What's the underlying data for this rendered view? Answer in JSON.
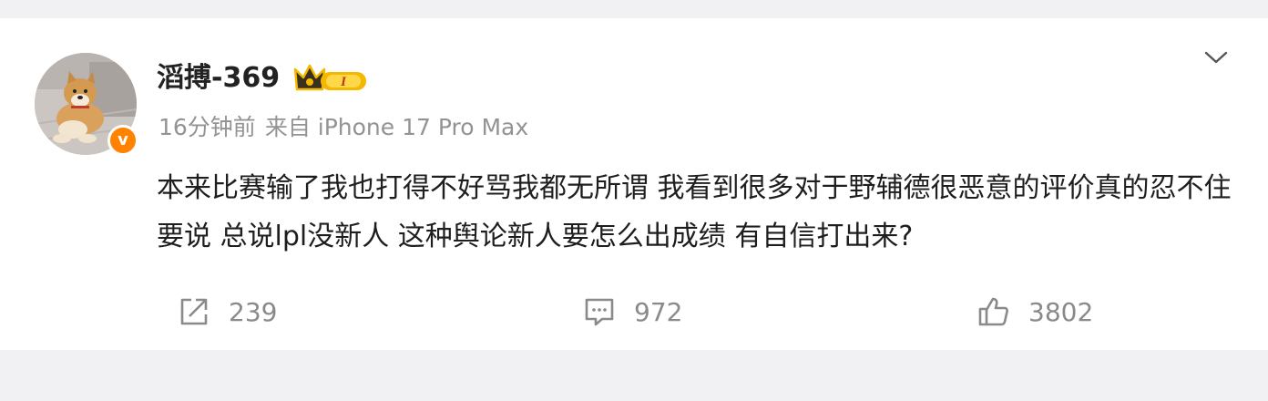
{
  "post": {
    "username": "滔搏-369",
    "level_badge": "I",
    "time": "16分钟前",
    "source": "来自 iPhone 17 Pro Max",
    "verified_mark": "v",
    "text": "本来比赛输了我也打得不好骂我都无所谓  我看到很多对于野辅德很恶意的评价真的忍不住要说 总说lpl没新人 这种舆论新人要怎么出成绩 有自信打出来?"
  },
  "actions": {
    "shares": "239",
    "comments": "972",
    "likes": "3802"
  },
  "icons": {
    "menu": "chevron-down-icon",
    "share": "share-icon",
    "comment": "comment-icon",
    "like": "thumbs-up-icon",
    "badge": "crown-icon"
  },
  "colors": {
    "verified": "#ff8200",
    "crown": "#f5b800",
    "meta_text": "#939393",
    "action_text": "#8a8a8a"
  }
}
